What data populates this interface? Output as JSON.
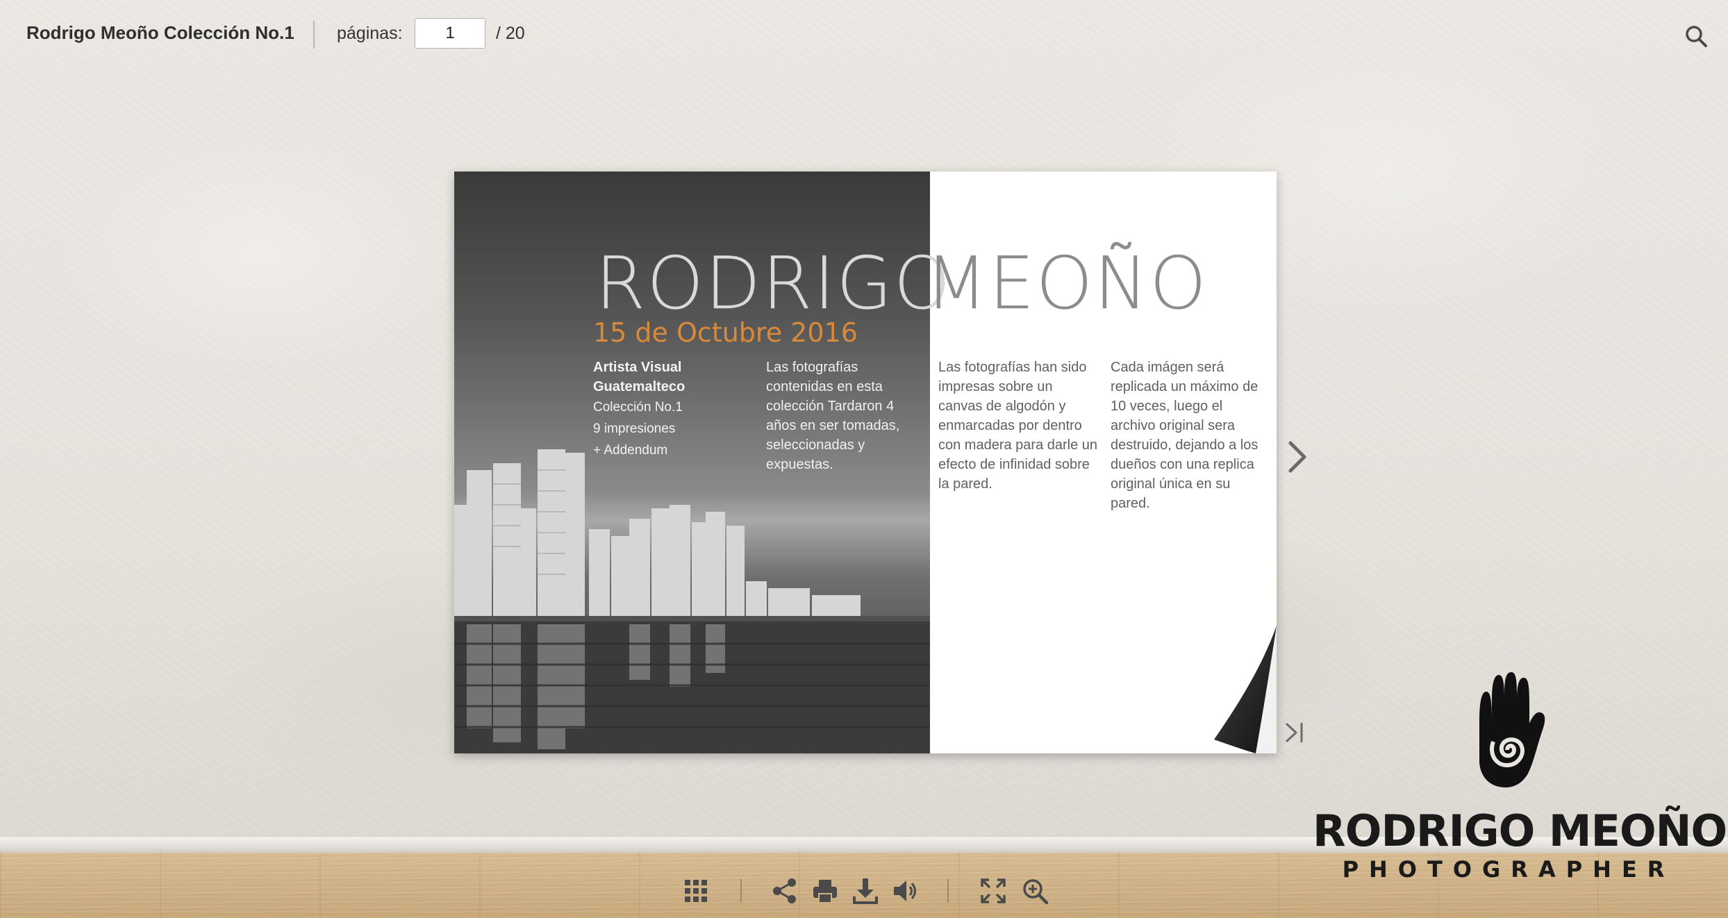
{
  "header": {
    "title": "Rodrigo Meoño Colección No.1",
    "pages_label": "páginas:",
    "current_page": "1",
    "total_pages": "/  20"
  },
  "book": {
    "title_left": "RODRIGO",
    "title_right": "MEOÑO",
    "date": "15 de Octubre 2016",
    "col1": {
      "line1": "Artista Visual",
      "line2": "Guatemalteco",
      "line3": "Colección No.1",
      "line4": "9 impresiones",
      "line5": "+ Addendum"
    },
    "col2": "Las fotografías contenidas en esta colección Tardaron 4 años en ser tomadas, seleccionadas y expuestas.",
    "col3": "Las fotografías han sido impresas sobre un canvas de algodón y enmarcadas por dentro con madera para darle un efecto de infinidad sobre la pared.",
    "col4": "Cada imágen será replicada un máximo de 10 veces, luego el archivo original sera destruido, dejando a los dueños con una replica original única en su pared."
  },
  "brand": {
    "name": "RODRIGO MEOÑO",
    "tagline": "PHOTOGRAPHER"
  },
  "icons": {
    "search": "search-icon",
    "next": "chevron-right-icon",
    "last": "last-page-icon",
    "thumbnails": "grid-icon",
    "share": "share-icon",
    "print": "print-icon",
    "download": "download-icon",
    "sound": "speaker-icon",
    "fullscreen": "fullscreen-icon",
    "zoom": "zoom-in-icon"
  },
  "colors": {
    "accent_date": "#d9893a",
    "icon": "#4a4a4a"
  }
}
